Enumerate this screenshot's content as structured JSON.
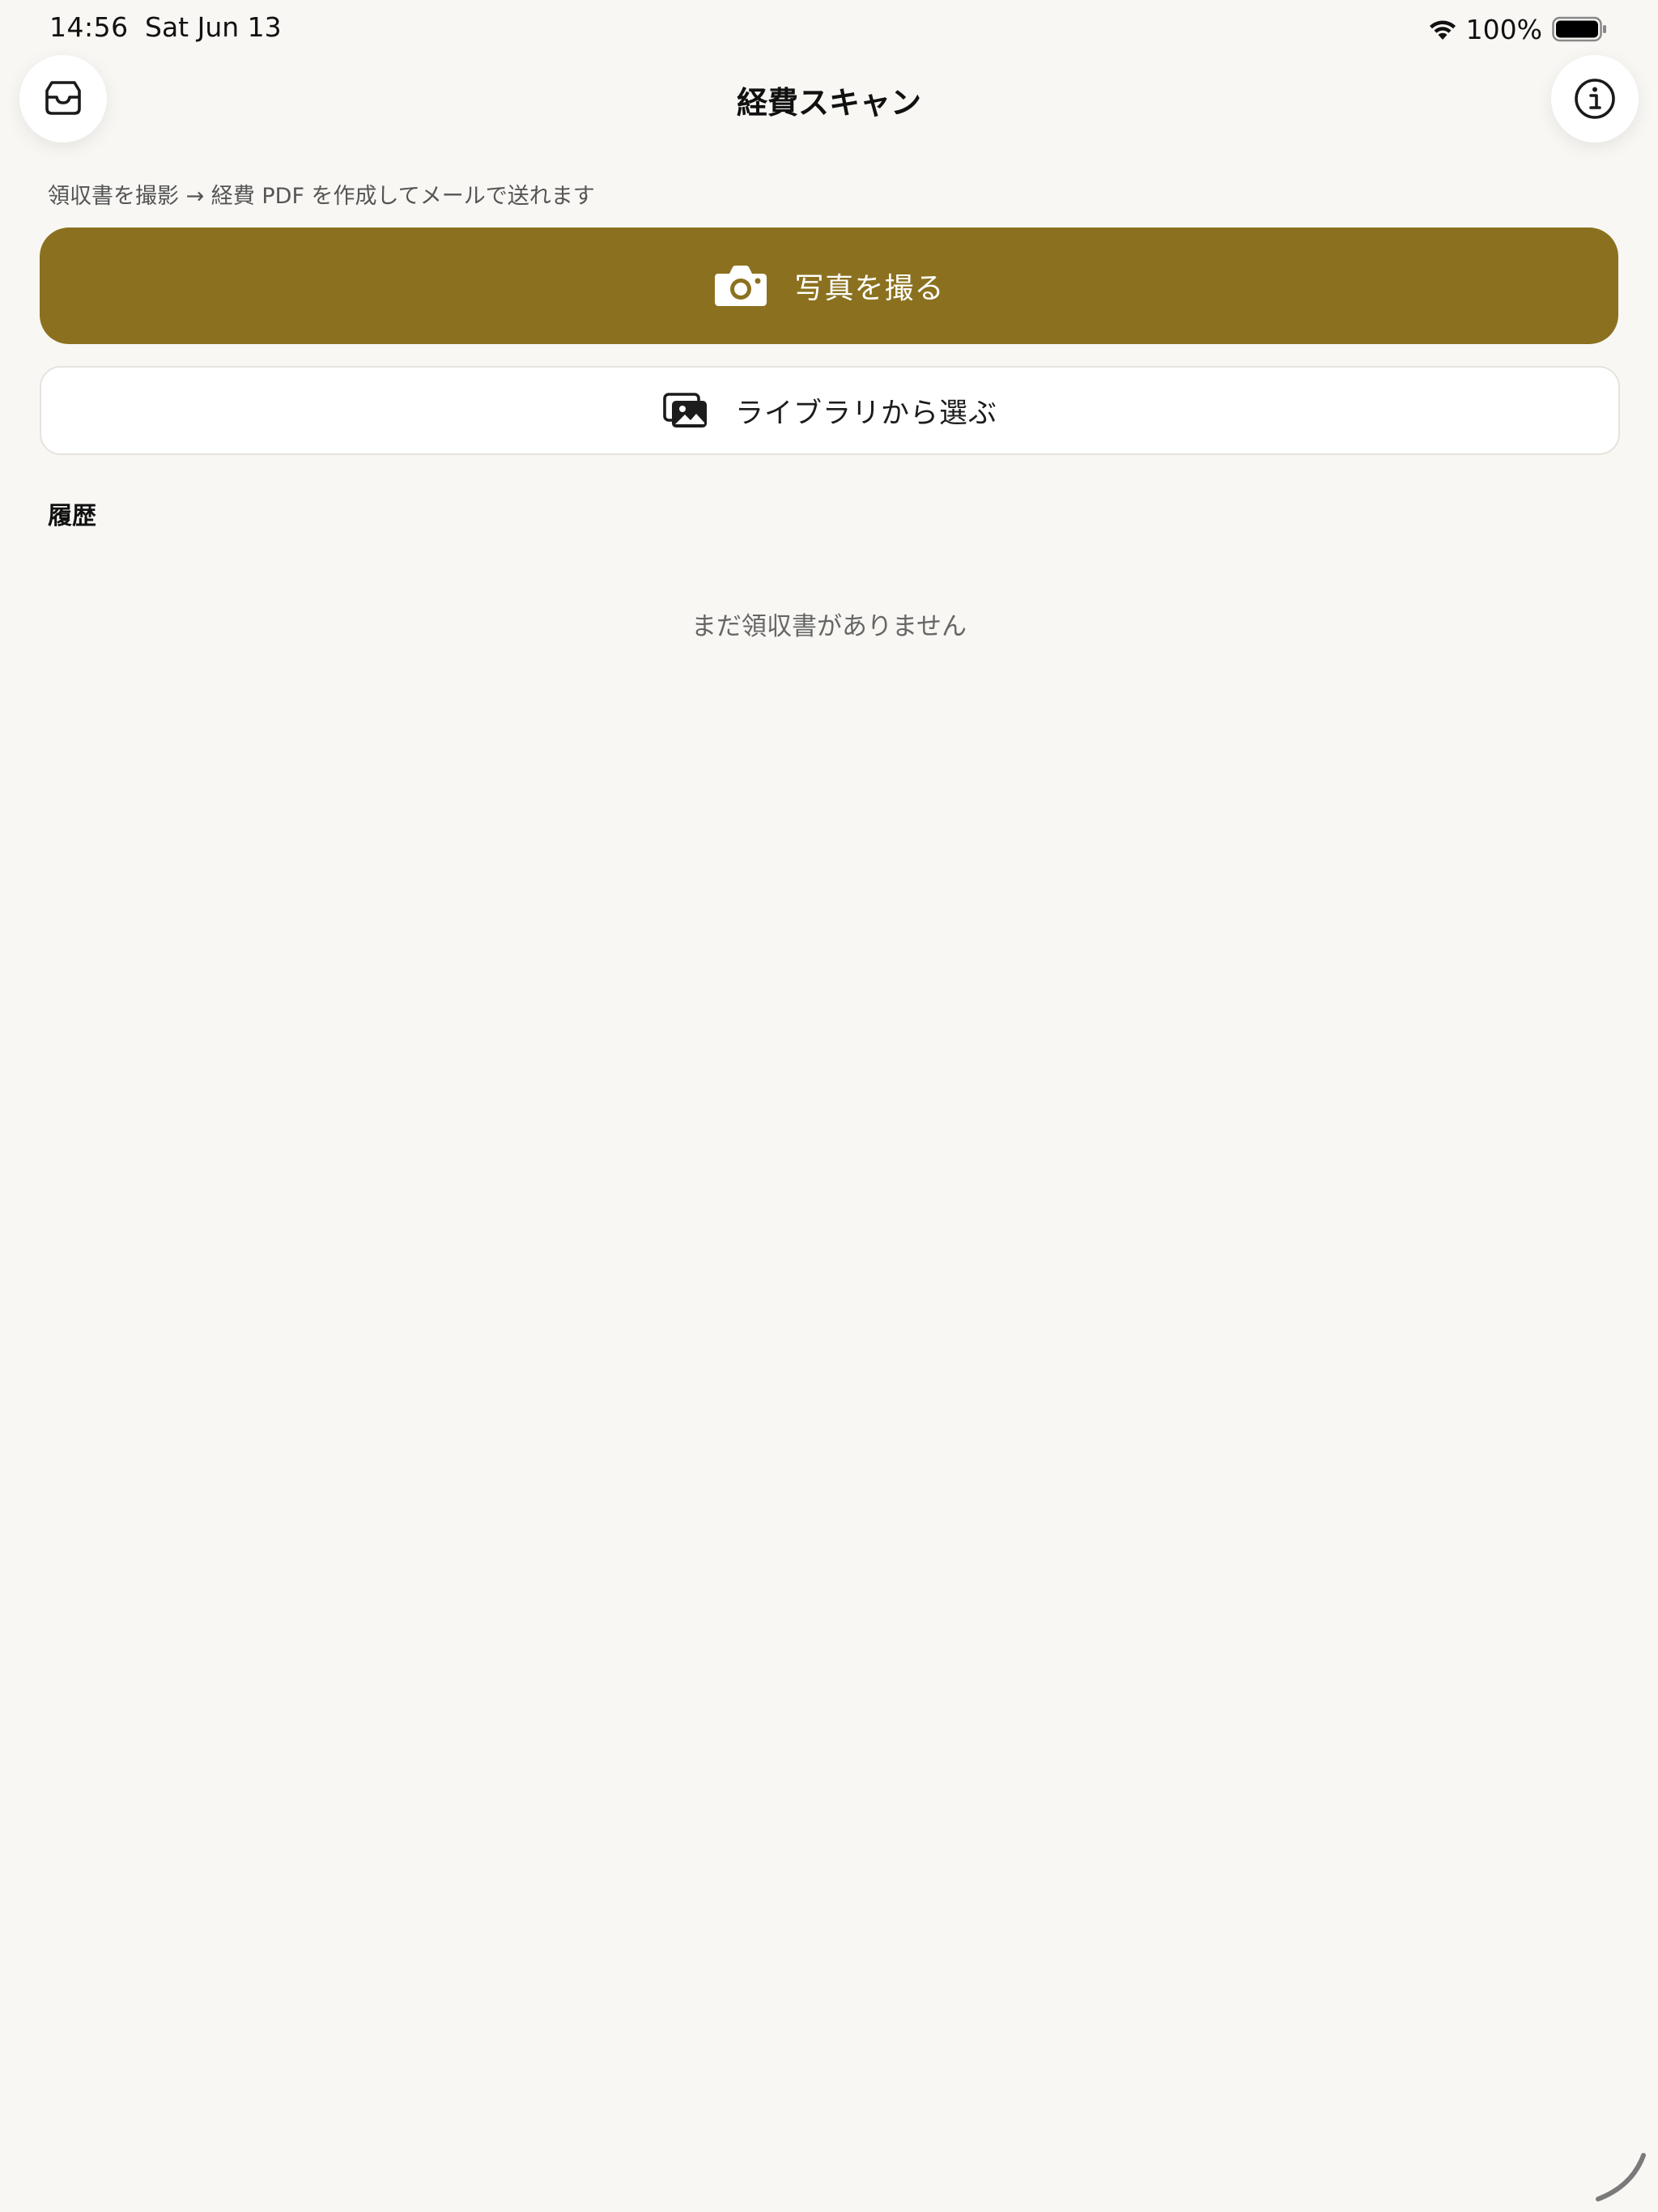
{
  "status_bar": {
    "time": "14:56",
    "date": "Sat Jun 13",
    "battery": "100%"
  },
  "nav": {
    "title": "経費スキャン",
    "left_icon": "inbox-icon",
    "right_icon": "info-icon"
  },
  "main": {
    "subtitle": "領収書を撮影 → 経費 PDF を作成してメールで送れます",
    "take_photo_label": "写真を撮る",
    "choose_library_label": "ライブラリから選ぶ",
    "history_header": "履歴",
    "empty_message": "まだ領収書がありません"
  },
  "colors": {
    "background": "#f8f7f4",
    "accent": "#8b711f",
    "card": "#ffffff"
  }
}
